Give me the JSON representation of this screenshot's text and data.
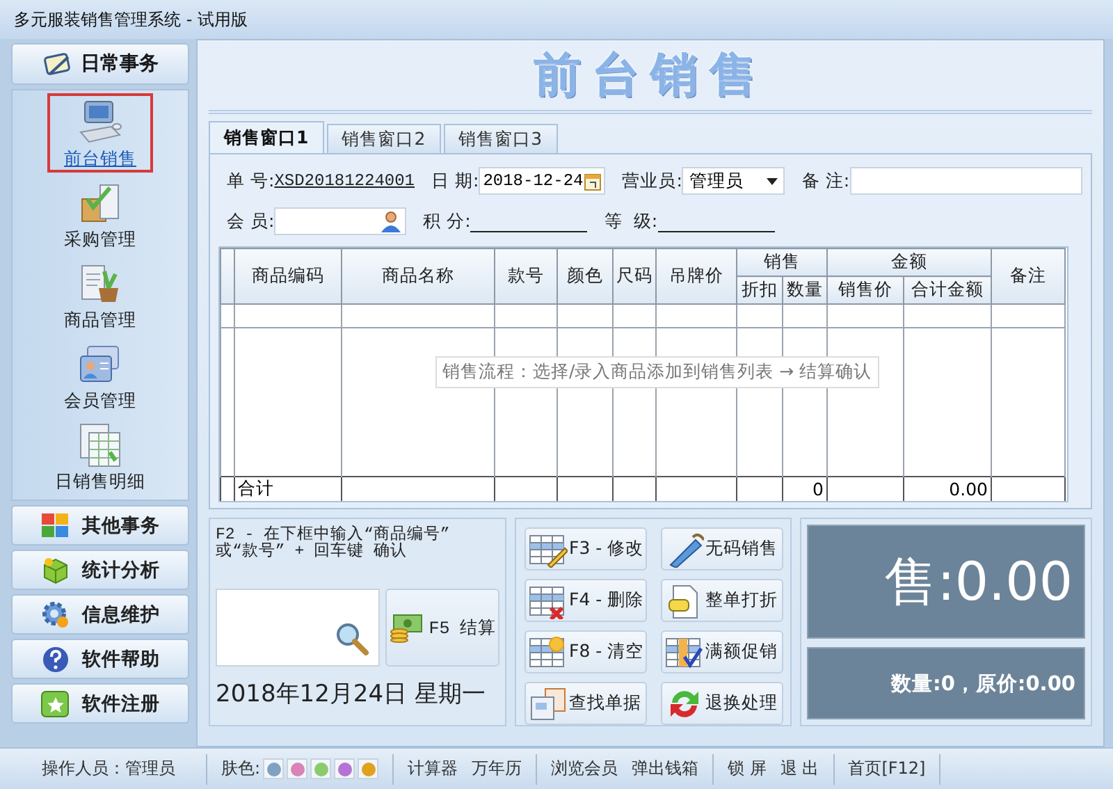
{
  "window": {
    "title": "多元服装销售管理系统 - 试用版"
  },
  "sidebar": {
    "header": "日常事务",
    "items": [
      {
        "label": "前台销售",
        "selected": true
      },
      {
        "label": "采购管理",
        "selected": false
      },
      {
        "label": "商品管理",
        "selected": false
      },
      {
        "label": "会员管理",
        "selected": false
      },
      {
        "label": "日销售明细",
        "selected": false
      }
    ],
    "sections": [
      "其他事务",
      "统计分析",
      "信息维护",
      "软件帮助",
      "软件注册"
    ]
  },
  "page_title": "前台销售",
  "tabs": [
    {
      "label": "销售窗口1",
      "selected": true
    },
    {
      "label": "销售窗口2",
      "selected": false
    },
    {
      "label": "销售窗口3",
      "selected": false
    }
  ],
  "form_rows": [
    [
      {
        "kind": "link",
        "label": "单 号:",
        "value": "XSD20181224001"
      },
      {
        "kind": "date",
        "label": "日 期:",
        "value": "2018-12-24"
      },
      {
        "kind": "select",
        "label": "营业员:",
        "value": "管理员"
      },
      {
        "kind": "input",
        "label": "备 注:"
      }
    ],
    [
      {
        "kind": "search",
        "label": "会 员:"
      },
      {
        "kind": "line",
        "label": "积 分:"
      },
      {
        "kind": "line",
        "label": "等  级:"
      }
    ]
  ],
  "table": {
    "columns": [
      {
        "label": "商品编码"
      },
      {
        "label": "商品名称"
      },
      {
        "label": "款号"
      },
      {
        "label": "颜色"
      },
      {
        "label": "尺码"
      },
      {
        "label": "吊牌价"
      },
      {
        "label": "销售",
        "children": [
          {
            "label": "折扣"
          },
          {
            "label": "数量"
          }
        ]
      },
      {
        "label": "金额",
        "children": [
          {
            "label": "销售价"
          },
          {
            "label": "合计金额"
          }
        ]
      },
      {
        "label": "备注"
      }
    ],
    "hint": "销售流程：选择/录入商品添加到销售列表 → 结算确认",
    "total_row": {
      "label": "合计",
      "quantity": "0",
      "amount": "0.00"
    }
  },
  "entry": {
    "instruction": "F2 - 在下框中输入“商品编号” 或“款号” + 回车键 确认",
    "checkout_button": "F5 结算",
    "date": "2018年12月24日 星期一"
  },
  "actions": [
    {
      "label": "F3 - 修改"
    },
    {
      "label": "无码销售"
    },
    {
      "label": "F4 - 删除"
    },
    {
      "label": "整单打折"
    },
    {
      "label": "F8 - 清空"
    },
    {
      "label": "满额促销"
    },
    {
      "label": "查找单据"
    },
    {
      "label": "退换处理"
    }
  ],
  "display": {
    "total": "售:0.00",
    "summary": "数量:0，原价:0.00"
  },
  "status_bar": {
    "operator": "操作人员：管理员",
    "skin_label": "肤色:",
    "skins": [
      {
        "color": "#7fa2c2"
      },
      {
        "color": "#d884b6"
      },
      {
        "color": "#8ccb6c"
      },
      {
        "color": "#b472d6"
      },
      {
        "color": "#e0a21c"
      }
    ],
    "link_groups": [
      [
        "计算器",
        "万年历"
      ],
      [
        "浏览会员",
        "弹出钱箱"
      ],
      [
        "锁 屏",
        "退 出"
      ],
      [
        "首页[F12]"
      ]
    ]
  }
}
